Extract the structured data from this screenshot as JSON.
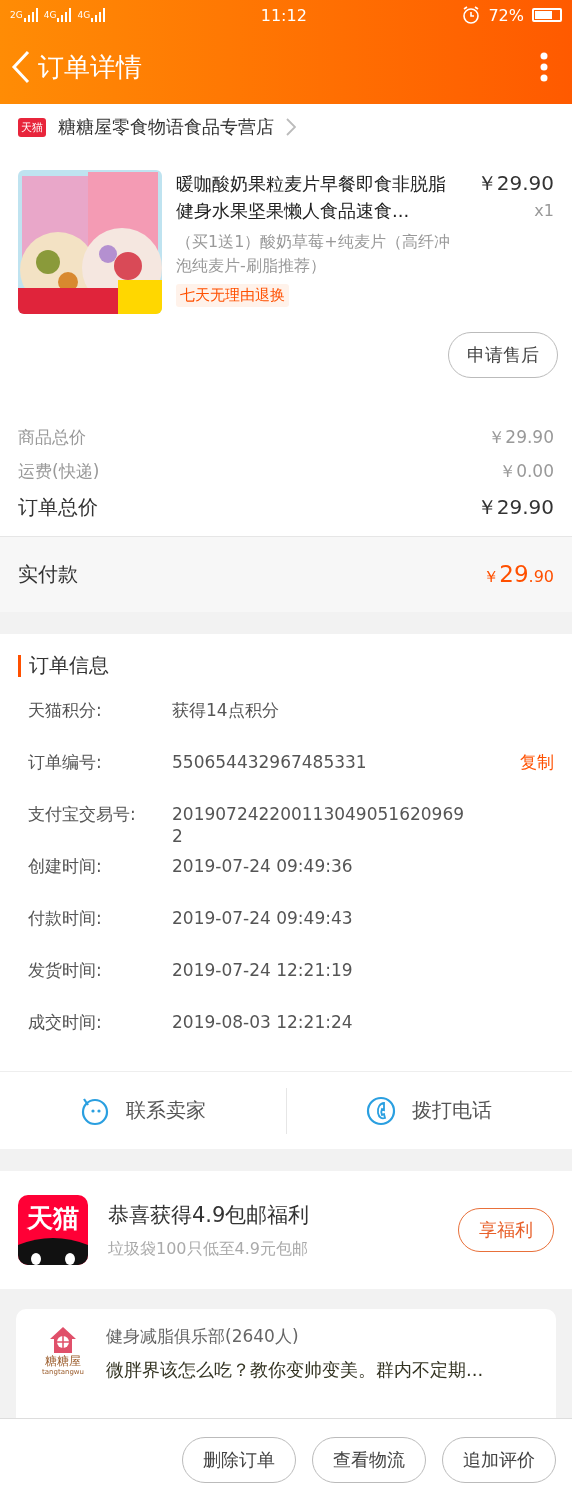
{
  "status_bar": {
    "networks": [
      "2G",
      "4G",
      "4G"
    ],
    "time": "11:12",
    "battery": "72%"
  },
  "nav": {
    "title": "订单详情"
  },
  "shop": {
    "badge": "天猫",
    "name": "糖糖屋零食物语食品专营店"
  },
  "product": {
    "kind": "picture",
    "title": "暖咖酸奶果粒麦片早餐即食非脱脂健身水果坚果懒人食品速食...",
    "price": "￥29.90",
    "quantity": "x1",
    "sku": "（买1送1）酸奶草莓+纯麦片（高纤冲泡纯麦片-刷脂推荐）",
    "tag": "七天无理由退换",
    "after_sale_button": "申请售后"
  },
  "price_rows": [
    {
      "label": "商品总价",
      "value": "￥29.90",
      "kind": "minor"
    },
    {
      "label": "运费(快递)",
      "value": "￥0.00",
      "kind": "minor"
    },
    {
      "label": "订单总价",
      "value": "￥29.90",
      "kind": "major"
    }
  ],
  "paid": {
    "label": "实付款",
    "currency": "￥",
    "integer": "29",
    "decimal": ".90"
  },
  "order_info": {
    "title": "订单信息",
    "rows": [
      {
        "label": "天猫积分:",
        "value": "获得14点积分"
      },
      {
        "label": "订单编号:",
        "value": "550654432967485331",
        "action": "复制"
      },
      {
        "label": "支付宝交易号:",
        "value": "2019072422001130490516209692"
      },
      {
        "label": "创建时间:",
        "value": "2019-07-24 09:49:36"
      },
      {
        "label": "付款时间:",
        "value": "2019-07-24 09:49:43"
      },
      {
        "label": "发货时间:",
        "value": "2019-07-24 12:21:19"
      },
      {
        "label": "成交时间:",
        "value": "2019-08-03 12:21:24"
      }
    ]
  },
  "contact_actions": [
    {
      "label": "联系卖家",
      "kind": "chat"
    },
    {
      "label": "拨打电话",
      "kind": "phone"
    }
  ],
  "promo": {
    "logo": "天猫",
    "title": "恭喜获得4.9包邮福利",
    "subtitle": "垃圾袋100只低至4.9元包邮",
    "button": "享福利"
  },
  "group": {
    "logo_name": "糖糖屋",
    "logo_latin": "tangtangwu",
    "name": "健身减脂俱乐部(2640人)",
    "message": "微胖界该怎么吃？教你变帅变美。群内不定期..."
  },
  "bottom_buttons": [
    "删除订单",
    "查看物流",
    "追加评价"
  ]
}
